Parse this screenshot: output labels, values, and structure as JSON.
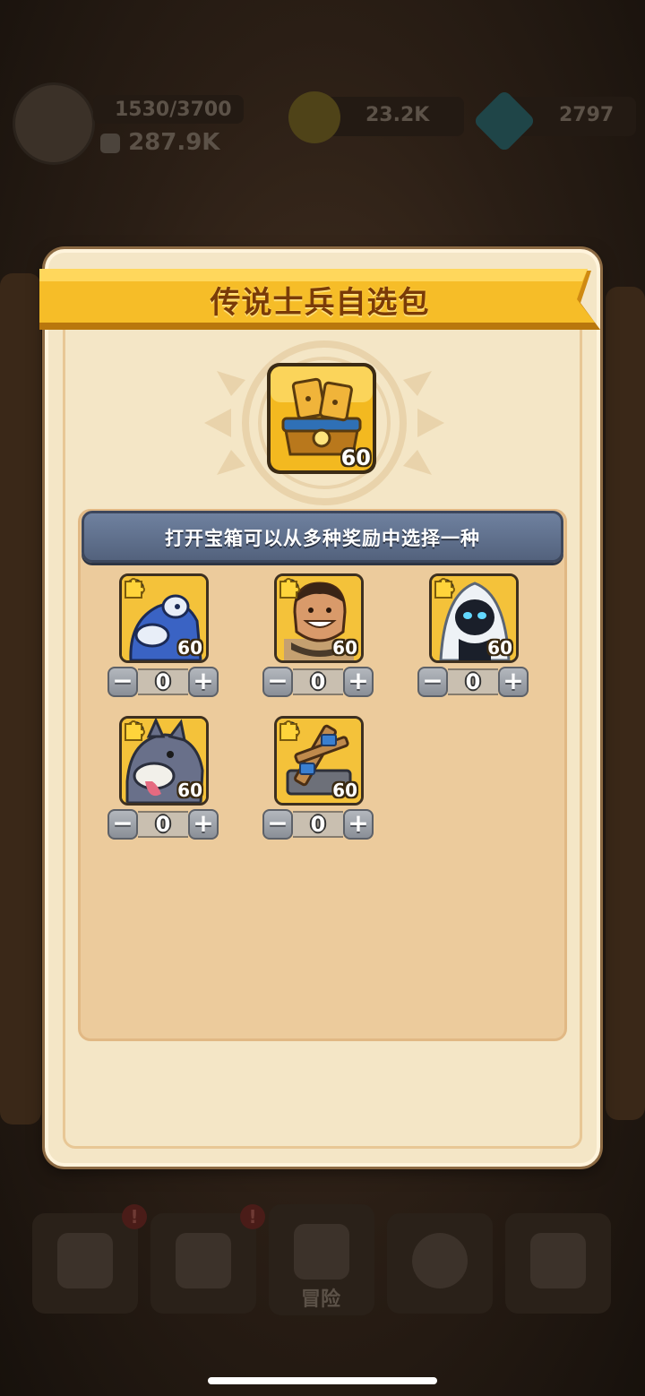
{
  "background": {
    "player_xp": "1530/3700",
    "player_power": "287.9K",
    "gold": "23.2K",
    "gems": "2797",
    "nav_adventure_label": "冒险",
    "alert_mark": "!"
  },
  "modal": {
    "title": "传说士兵自选包",
    "chest": {
      "icon": "golden-treasure-chest-icon",
      "level": "60"
    },
    "banner": "打开宝箱可以从多种奖励中选择一种"
  },
  "units": [
    {
      "element": "water",
      "portrait": "blue-dog-warrior-portrait-icon",
      "level": "60",
      "minus": "−",
      "count": "0",
      "plus": "+"
    },
    {
      "element": "fire",
      "portrait": "smiling-strongman-portrait-icon",
      "level": "60",
      "minus": "−",
      "count": "0",
      "plus": "+"
    },
    {
      "element": "water",
      "portrait": "white-hooded-mage-portrait-icon",
      "level": "60",
      "minus": "−",
      "count": "0",
      "plus": "+"
    },
    {
      "element": "water",
      "portrait": "gray-wolf-portrait-icon",
      "level": "60",
      "minus": "−",
      "count": "0",
      "plus": "+"
    },
    {
      "element": "nature",
      "portrait": "wooden-ballista-portrait-icon",
      "level": "60",
      "minus": "−",
      "count": "0",
      "plus": "+"
    }
  ],
  "colors": {
    "ribbon": "#f4b824",
    "banner": "#5f6f8c",
    "panel": "#eccb9c",
    "card": "#f4c23a",
    "water": "#3fa3e6",
    "fire": "#e0521c",
    "nature": "#4bb648"
  }
}
